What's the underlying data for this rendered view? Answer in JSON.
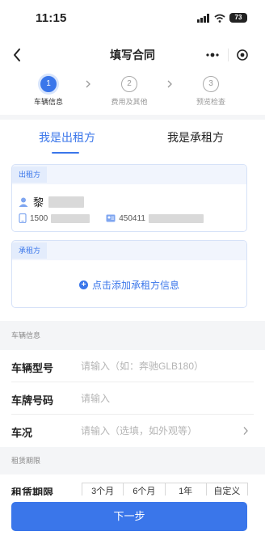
{
  "status_bar": {
    "time": "11:15",
    "battery": "73"
  },
  "nav": {
    "title": "填写合同"
  },
  "steps": [
    {
      "number": "1",
      "label": "车辆信息",
      "active": true
    },
    {
      "number": "2",
      "label": "费用及其他",
      "active": false
    },
    {
      "number": "3",
      "label": "预览检查",
      "active": false
    }
  ],
  "role_tabs": {
    "lessor": "我是出租方",
    "lessee": "我是承租方",
    "selected": "lessor"
  },
  "lessor_card": {
    "tag": "出租方",
    "name_prefix": "黎",
    "phone_prefix": "1500",
    "id_prefix": "450411"
  },
  "lessee_card": {
    "tag": "承租方",
    "add_label": "点击添加承租方信息"
  },
  "vehicle_section": {
    "title": "车辆信息",
    "model_label": "车辆型号",
    "model_placeholder": "请输入（如：奔驰GLB180）",
    "plate_label": "车牌号码",
    "plate_placeholder": "请输入",
    "condition_label": "车况",
    "condition_placeholder": "请输入（选填，如外观等）"
  },
  "rent_section": {
    "title": "租赁期限",
    "period_label": "租赁期限",
    "options": [
      "3个月",
      "6个月",
      "1年",
      "自定义"
    ]
  },
  "next_button": "下一步",
  "colors": {
    "accent": "#3a76ea",
    "section_bg": "#f4f5f7",
    "card_border": "#d6e2f8"
  }
}
